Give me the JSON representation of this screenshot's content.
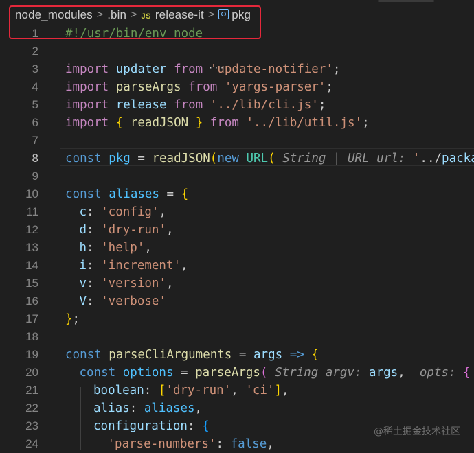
{
  "breadcrumb": {
    "items": [
      "node_modules",
      ".bin",
      "release-it",
      "pkg"
    ],
    "separator": ">",
    "file_type_badge": "JS"
  },
  "editor": {
    "active_line": 8,
    "lines": [
      {
        "num": "1",
        "text": "#!/usr/bin/env node"
      },
      {
        "num": "2",
        "text": ""
      },
      {
        "num": "3",
        "text": "import updater from 'update-notifier';"
      },
      {
        "num": "4",
        "text": "import parseArgs from 'yargs-parser';"
      },
      {
        "num": "5",
        "text": "import release from '../lib/cli.js';"
      },
      {
        "num": "6",
        "text": "import { readJSON } from '../lib/util.js';"
      },
      {
        "num": "7",
        "text": ""
      },
      {
        "num": "8",
        "text": "const pkg = readJSON(new URL( String | URL url: '../packag"
      },
      {
        "num": "9",
        "text": ""
      },
      {
        "num": "10",
        "text": "const aliases = {"
      },
      {
        "num": "11",
        "text": "c: 'config',"
      },
      {
        "num": "12",
        "text": "d: 'dry-run',"
      },
      {
        "num": "13",
        "text": "h: 'help',"
      },
      {
        "num": "14",
        "text": "i: 'increment',"
      },
      {
        "num": "15",
        "text": "v: 'version',"
      },
      {
        "num": "16",
        "text": "V: 'verbose'"
      },
      {
        "num": "17",
        "text": "};"
      },
      {
        "num": "18",
        "text": ""
      },
      {
        "num": "19",
        "text": "const parseCliArguments = args => {"
      },
      {
        "num": "20",
        "text": "const options = parseArgs( String argv: args,  opts: {"
      },
      {
        "num": "21",
        "text": "boolean: ['dry-run', 'ci'],"
      },
      {
        "num": "22",
        "text": "alias: aliases,"
      },
      {
        "num": "23",
        "text": "configuration: {"
      },
      {
        "num": "24",
        "text": "'parse-numbers': false,"
      }
    ]
  },
  "watermark": "@稀土掘金技术社区",
  "colors": {
    "background": "#1f1f1f",
    "keyword": "#569cd6",
    "control_keyword": "#c586c0",
    "function": "#dcdcaa",
    "variable": "#9cdcfe",
    "string": "#ce9178",
    "comment": "#6a9955",
    "highlight_box": "#e5283b"
  }
}
